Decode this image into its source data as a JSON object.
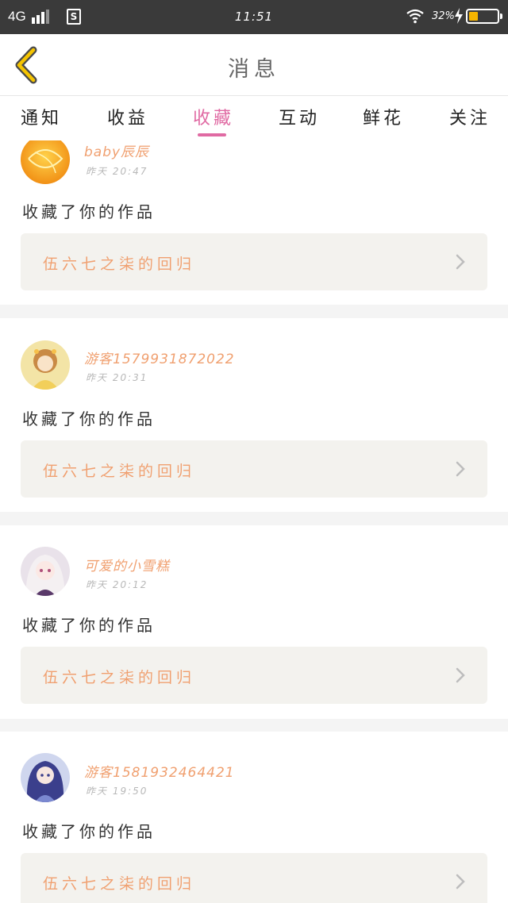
{
  "status_bar": {
    "network": "4G",
    "time": "11:51",
    "battery_percent": "32%",
    "battery_level": 0.32,
    "icons": [
      "signal-icon",
      "app-s-icon",
      "wifi-icon",
      "charging-bolt-icon",
      "battery-icon"
    ]
  },
  "header": {
    "title": "消息",
    "back_icon": "chevron-left-icon",
    "accent_color": "#f5c400"
  },
  "tabs": {
    "items": [
      {
        "label": "通知"
      },
      {
        "label": "收益"
      },
      {
        "label": "收藏",
        "active": true
      },
      {
        "label": "互动"
      },
      {
        "label": "鲜花"
      },
      {
        "label": "关注"
      }
    ],
    "active_color": "#e06aa3"
  },
  "messages": [
    {
      "username": "baby辰辰",
      "time": "昨天 20:47",
      "action": "收藏了你的作品",
      "work_title": "伍六七之柒的回归"
    },
    {
      "username": "游客1579931872022",
      "time": "昨天 20:31",
      "action": "收藏了你的作品",
      "work_title": "伍六七之柒的回归"
    },
    {
      "username": "可爱的小雪糕",
      "time": "昨天 20:12",
      "action": "收藏了你的作品",
      "work_title": "伍六七之柒的回归"
    },
    {
      "username": "游客1581932464421",
      "time": "昨天 19:50",
      "action": "收藏了你的作品",
      "work_title": "伍六七之柒的回归"
    }
  ],
  "colors": {
    "username": "#f0a070",
    "work_box_bg": "#f3f2ee",
    "status_bar_bg": "#3a3a3a"
  }
}
